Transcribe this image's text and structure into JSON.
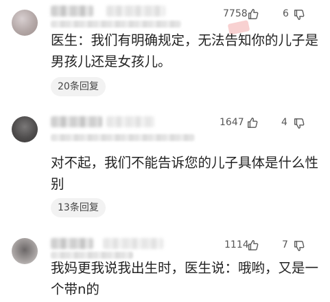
{
  "comments": [
    {
      "likes": "7758",
      "dislikes": "6",
      "text": "医生：我们有明确规定，无法告知你的儿子是男孩儿还是女孩儿。",
      "replies": "20条回复"
    },
    {
      "likes": "1647",
      "dislikes": "4",
      "text": "对不起，我们不能告诉您的儿子具体是什么性别",
      "replies": "13条回复"
    },
    {
      "likes": "1114",
      "dislikes": "7",
      "text": "我妈更我说我出生时，医生说：哦哟，又是一个带n的"
    }
  ],
  "icons": {
    "like": "thumbs-up-icon",
    "dislike": "thumbs-down-icon"
  }
}
